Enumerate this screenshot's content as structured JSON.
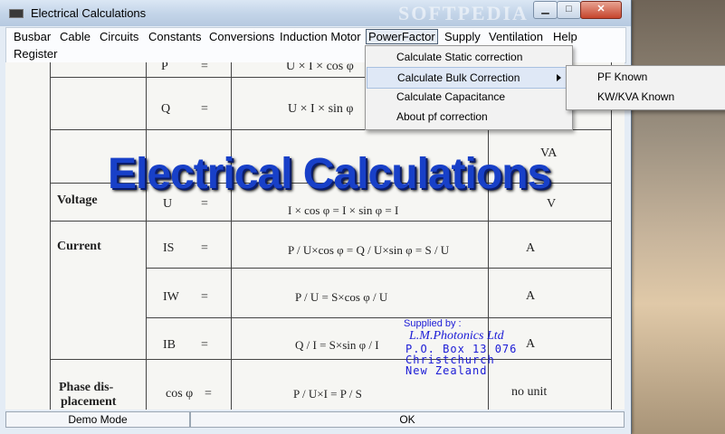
{
  "window": {
    "title": "Electrical Calculations",
    "watermark": "SOFTPEDIA"
  },
  "menubar": {
    "items": [
      "Busbar",
      "Cable",
      "Circuits",
      "Constants",
      "Conversions",
      "Induction Motor",
      "PowerFactor",
      "Supply",
      "Ventilation",
      "Help",
      "Register"
    ],
    "active": "PowerFactor"
  },
  "powerfactor_menu": {
    "items": [
      "Calculate Static correction",
      "Calculate Bulk Correction",
      "Calculate Capacitance",
      "About pf correction"
    ],
    "highlighted": "Calculate Bulk Correction"
  },
  "bulk_submenu": {
    "items": [
      "PF Known",
      "KW/KVA Known"
    ]
  },
  "background": {
    "title": "Electrical Calculations",
    "rows": {
      "p_sym": "P",
      "p_eq": "=",
      "p_formula": "U × I × cos φ",
      "q_sym": "Q",
      "q_eq": "=",
      "q_formula": "U × I × sin φ",
      "va_unit": "VA",
      "voltage_label": "Voltage",
      "u_sym": "U",
      "u_eq": "=",
      "u_formula": "I × cos φ  =  I × sin φ  =  I",
      "v_unit": "V",
      "current_label": "Current",
      "is_sym": "IS",
      "is_eq": "=",
      "is_formula": "P / U×cos φ = Q / U×sin φ = S / U",
      "a_unit1": "A",
      "iw_sym": "IW",
      "iw_eq": "=",
      "iw_formula": "P / U = S×cos φ / U",
      "a_unit2": "A",
      "ib_sym": "IB",
      "ib_eq": "=",
      "ib_formula": "Q / I = S×sin φ / I",
      "a_unit3": "A",
      "phase_label": "Phase dis-",
      "phase_label2": "placement",
      "cos_sym": "cos φ",
      "cos_eq": "=",
      "cos_formula": "P / U×I = P / S",
      "nounit": "no unit"
    }
  },
  "supplier": {
    "label": "Supplied by :",
    "company": "L.M.Photonics Ltd",
    "line1": "P.O. Box 13 076",
    "line2": "Christchurch",
    "line3": "New Zealand"
  },
  "status": {
    "mode": "Demo Mode",
    "message": "OK"
  },
  "icons": {
    "minimize": "minimize-icon",
    "maximize": "maximize-icon",
    "close": "close-icon",
    "submenu_arrow": "chevron-right-icon"
  }
}
